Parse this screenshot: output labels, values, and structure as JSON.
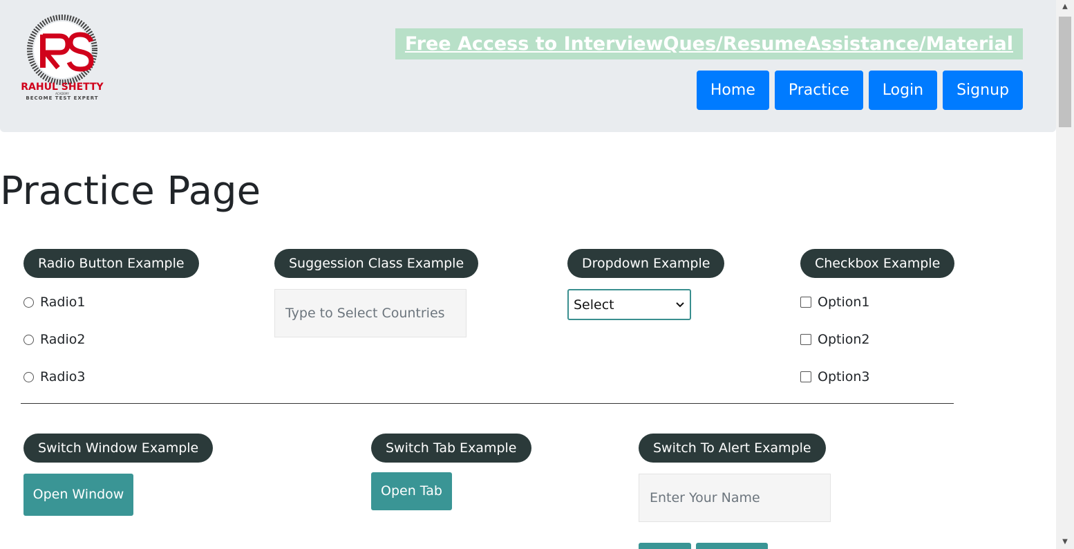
{
  "header": {
    "logo": {
      "initials": "RS",
      "name": "RAHUL SHETTY",
      "sub": "ACADEMY",
      "tagline": "BECOME TEST EXPERT",
      "color": "#d0021b"
    },
    "promo_link": "Free Access to InterviewQues/ResumeAssistance/Material",
    "nav": [
      "Home",
      "Practice",
      "Login",
      "Signup"
    ]
  },
  "main": {
    "title": "Practice Page",
    "radio_section": {
      "legend": "Radio Button Example",
      "options": [
        "Radio1",
        "Radio2",
        "Radio3"
      ]
    },
    "suggestion_section": {
      "legend": "Suggession Class Example",
      "placeholder": "Type to Select Countries"
    },
    "dropdown_section": {
      "legend": "Dropdown Example",
      "selected": "Select"
    },
    "checkbox_section": {
      "legend": "Checkbox Example",
      "options": [
        "Option1",
        "Option2",
        "Option3"
      ]
    },
    "switch_window": {
      "legend": "Switch Window Example",
      "button": "Open Window"
    },
    "switch_tab": {
      "legend": "Switch Tab Example",
      "button": "Open Tab"
    },
    "switch_alert": {
      "legend": "Switch To Alert Example",
      "placeholder": "Enter Your Name"
    }
  },
  "colors": {
    "nav_button": "#007bff",
    "legend_bg": "#2b3a3a",
    "teal_button": "#3a9595",
    "header_bg": "#e9ecef"
  }
}
